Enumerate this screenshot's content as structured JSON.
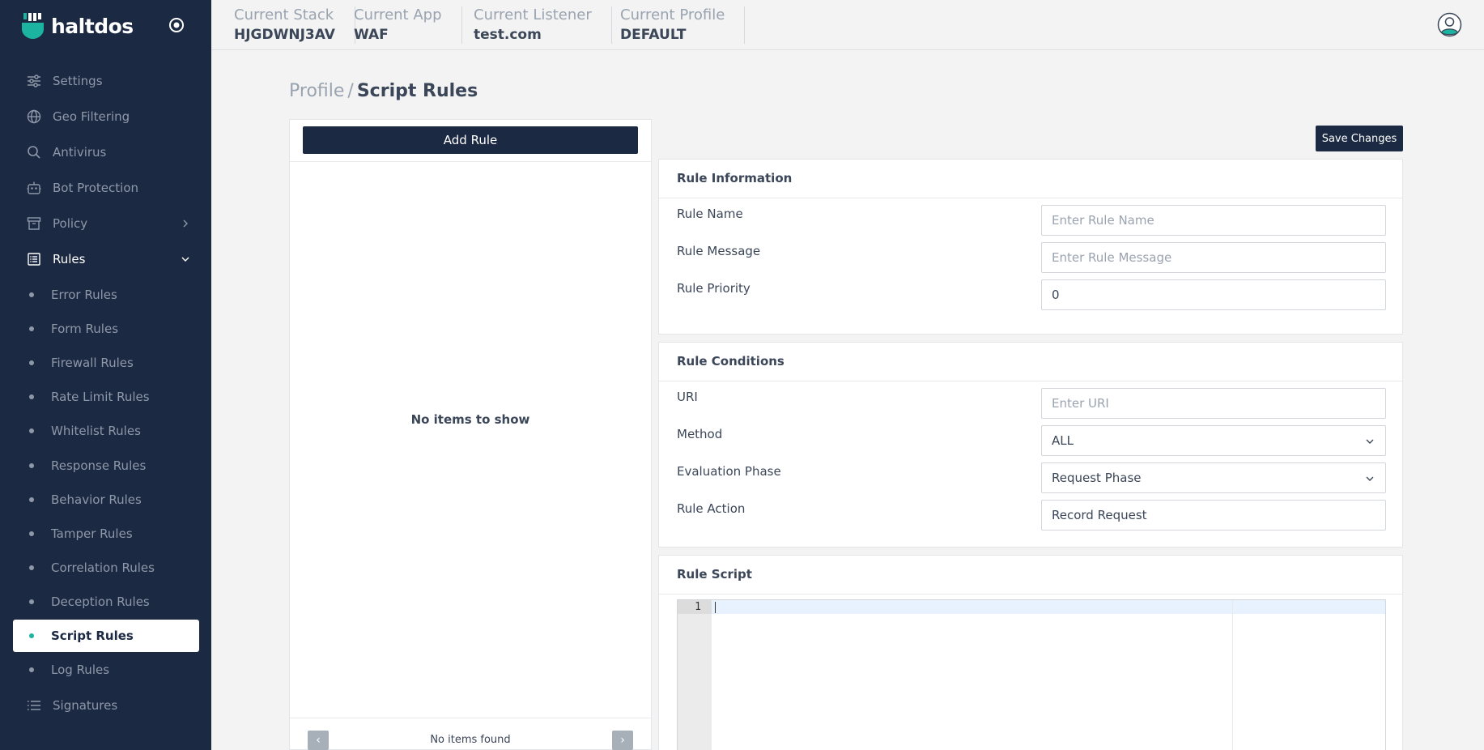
{
  "brand": {
    "name": "haltdos"
  },
  "sidebar": {
    "items": [
      {
        "label": "Settings",
        "icon": "sliders-icon"
      },
      {
        "label": "Geo Filtering",
        "icon": "globe-icon"
      },
      {
        "label": "Antivirus",
        "icon": "search-icon"
      },
      {
        "label": "Bot Protection",
        "icon": "robot-icon"
      },
      {
        "label": "Policy",
        "icon": "archive-icon"
      },
      {
        "label": "Rules",
        "icon": "list-box-icon"
      }
    ],
    "subitems": [
      "Error Rules",
      "Form Rules",
      "Firewall Rules",
      "Rate Limit Rules",
      "Whitelist Rules",
      "Response Rules",
      "Behavior Rules",
      "Tamper Rules",
      "Correlation Rules",
      "Deception Rules",
      "Script Rules",
      "Log Rules"
    ],
    "active_subitem": "Script Rules",
    "signatures": {
      "label": "Signatures",
      "icon": "list-icon"
    }
  },
  "topbar": {
    "stack": {
      "key": "Current Stack",
      "value": "HJGDWNJ3AV"
    },
    "app": {
      "key": "Current App",
      "value": "WAF"
    },
    "listener": {
      "key": "Current Listener",
      "value": "test.com"
    },
    "profile": {
      "key": "Current Profile",
      "value": "DEFAULT"
    }
  },
  "breadcrumb": {
    "parent": "Profile",
    "separator": "/",
    "current": "Script Rules"
  },
  "list": {
    "add_label": "Add Rule",
    "empty_text": "No items to show",
    "footer_text": "No items found",
    "prev": "‹",
    "next": "›"
  },
  "save_label": "Save Changes",
  "rule_info": {
    "title": "Rule Information",
    "name_label": "Rule Name",
    "name_placeholder": "Enter Rule Name",
    "message_label": "Rule Message",
    "message_placeholder": "Enter Rule Message",
    "priority_label": "Rule Priority",
    "priority_value": "0"
  },
  "rule_conditions": {
    "title": "Rule Conditions",
    "uri_label": "URI",
    "uri_placeholder": "Enter URI",
    "method_label": "Method",
    "method_value": "ALL",
    "phase_label": "Evaluation Phase",
    "phase_value": "Request Phase",
    "action_label": "Rule Action",
    "action_value": "Record Request"
  },
  "rule_script": {
    "title": "Rule Script",
    "line_number": "1"
  },
  "colors": {
    "sidebar_bg": "#1c2942",
    "accent": "#1cb3a0",
    "button_bg": "#1c2942"
  }
}
